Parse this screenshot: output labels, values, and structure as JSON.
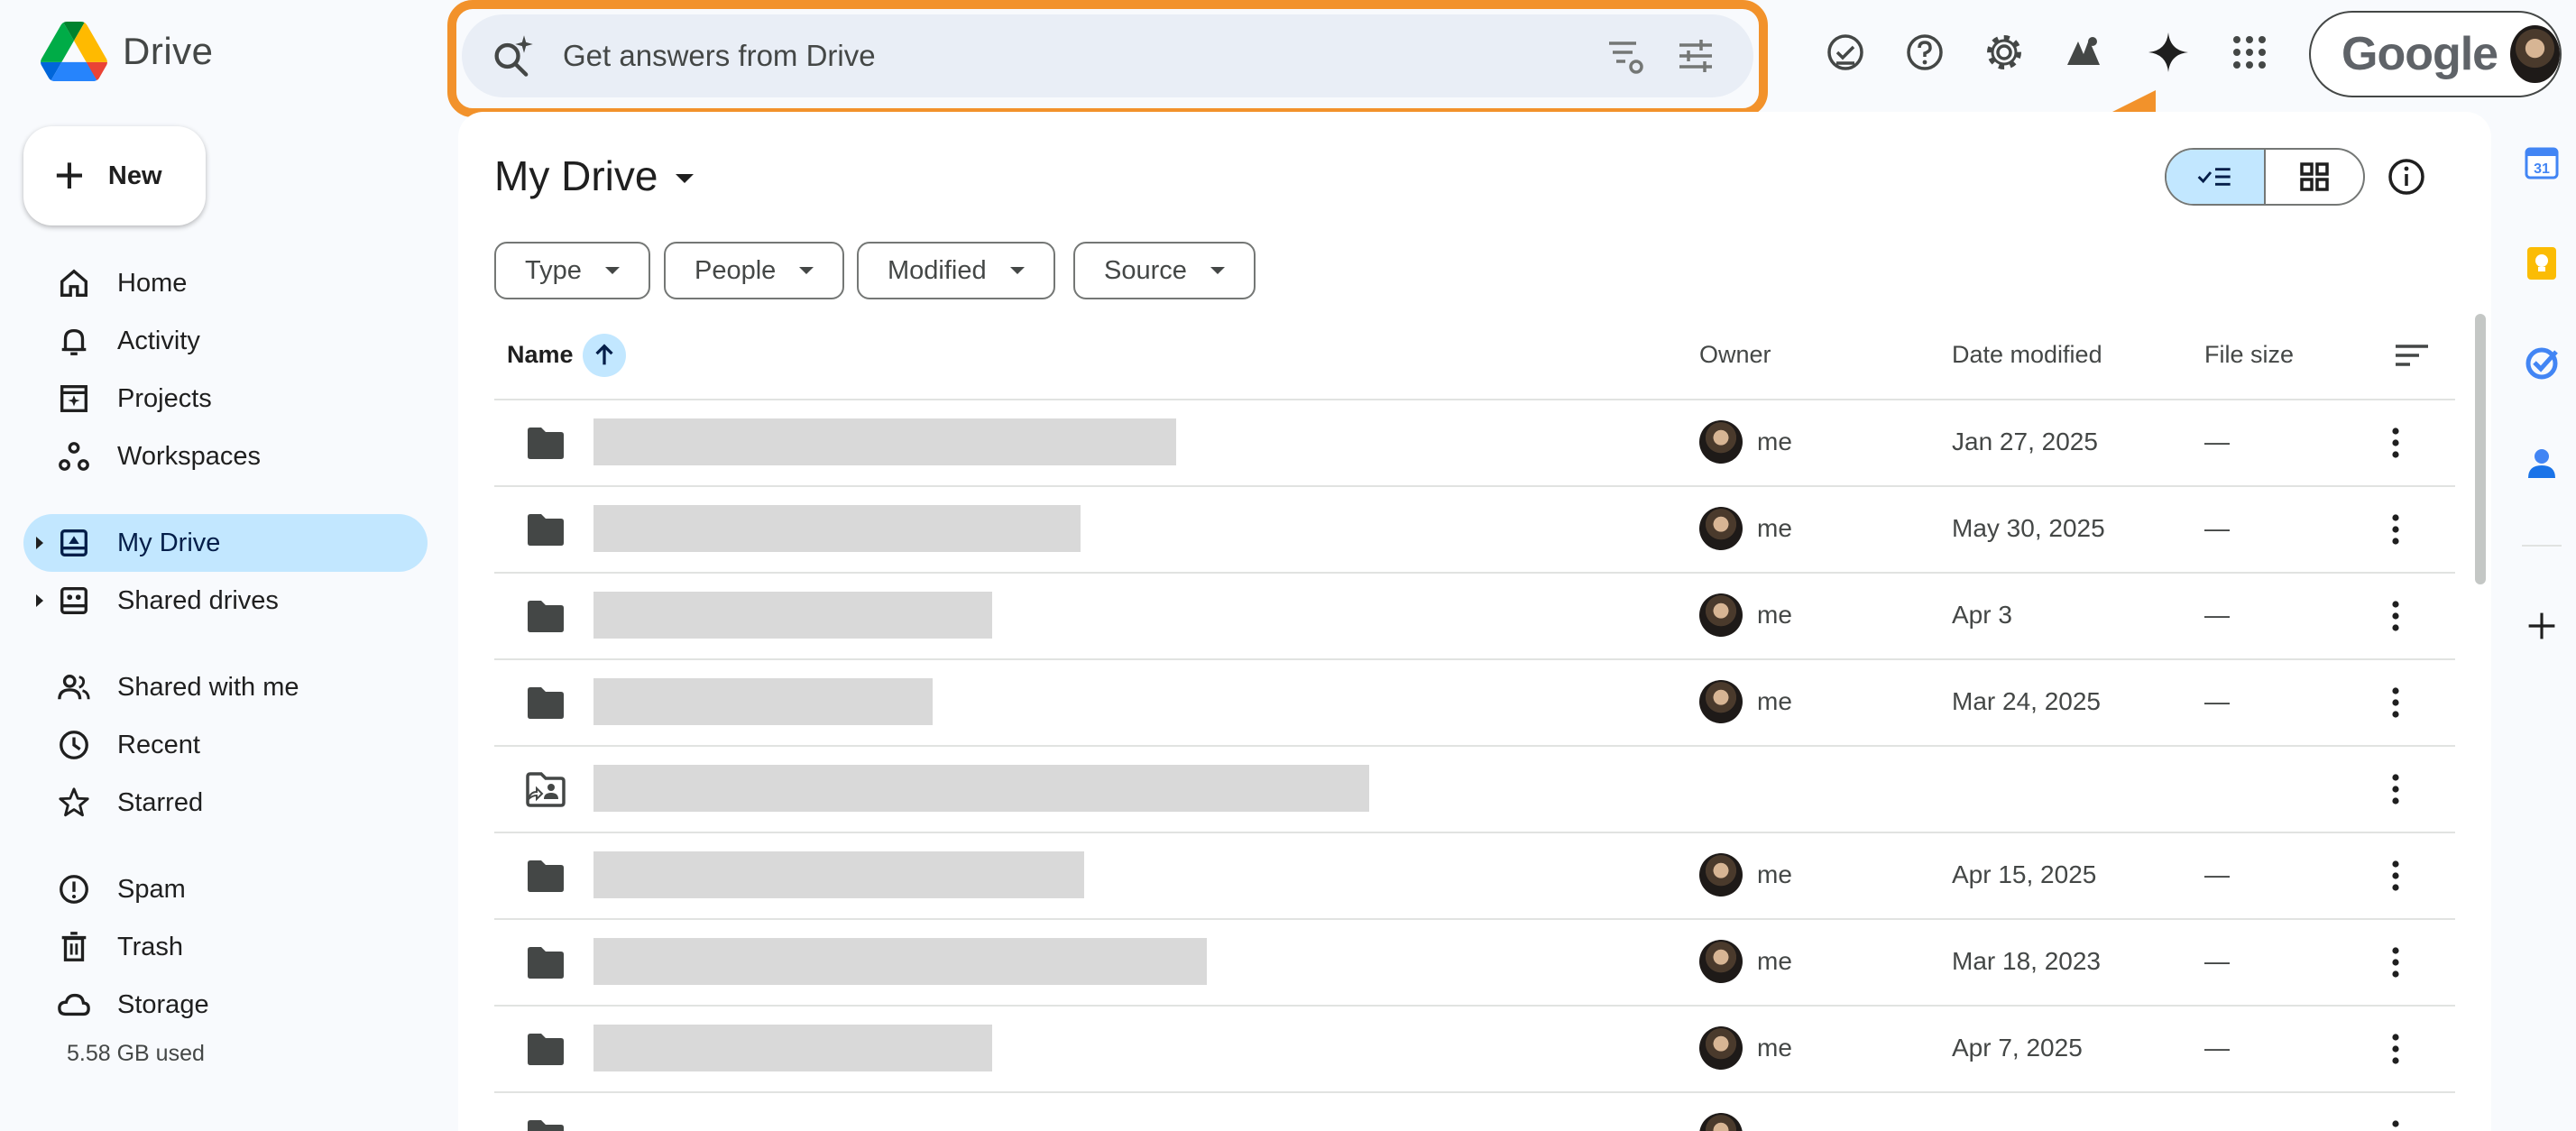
{
  "app": {
    "name": "Drive"
  },
  "search": {
    "placeholder": "Get answers from Drive"
  },
  "account": {
    "brand": "Google"
  },
  "sidebar": {
    "new_label": "New",
    "items": [
      {
        "label": "Home",
        "icon": "home-icon"
      },
      {
        "label": "Activity",
        "icon": "bell-icon"
      },
      {
        "label": "Projects",
        "icon": "projects-icon"
      },
      {
        "label": "Workspaces",
        "icon": "workspaces-icon"
      },
      {
        "label": "My Drive",
        "icon": "my-drive-icon",
        "active": true
      },
      {
        "label": "Shared drives",
        "icon": "shared-drives-icon"
      },
      {
        "label": "Shared with me",
        "icon": "people-icon"
      },
      {
        "label": "Recent",
        "icon": "clock-icon"
      },
      {
        "label": "Starred",
        "icon": "star-icon"
      },
      {
        "label": "Spam",
        "icon": "spam-icon"
      },
      {
        "label": "Trash",
        "icon": "trash-icon"
      },
      {
        "label": "Storage",
        "icon": "cloud-icon"
      }
    ],
    "storage_used": "5.58 GB used"
  },
  "main": {
    "title": "My Drive",
    "filters": [
      "Type",
      "People",
      "Modified",
      "Source"
    ],
    "columns": {
      "name": "Name",
      "owner": "Owner",
      "date": "Date modified",
      "size": "File size"
    },
    "rows": [
      {
        "type": "folder",
        "owner": "me",
        "date": "Jan 27, 2025",
        "size": "—"
      },
      {
        "type": "folder",
        "owner": "me",
        "date": "May 30, 2025",
        "size": "—"
      },
      {
        "type": "folder",
        "owner": "me",
        "date": "Apr 3",
        "size": "—"
      },
      {
        "type": "folder",
        "owner": "me",
        "date": "Mar 24, 2025",
        "size": "—"
      },
      {
        "type": "shortcut-shared-folder",
        "owner": "",
        "date": "",
        "size": ""
      },
      {
        "type": "folder",
        "owner": "me",
        "date": "Apr 15, 2025",
        "size": "—"
      },
      {
        "type": "folder",
        "owner": "me",
        "date": "Mar 18, 2023",
        "size": "—"
      },
      {
        "type": "folder",
        "owner": "me",
        "date": "Apr 7, 2025",
        "size": "—"
      },
      {
        "type": "folder",
        "owner": "",
        "date": "",
        "size": ""
      }
    ]
  },
  "colors": {
    "accent": "#c2e7ff",
    "highlight": "#f2922b",
    "background": "#f8fafd"
  }
}
